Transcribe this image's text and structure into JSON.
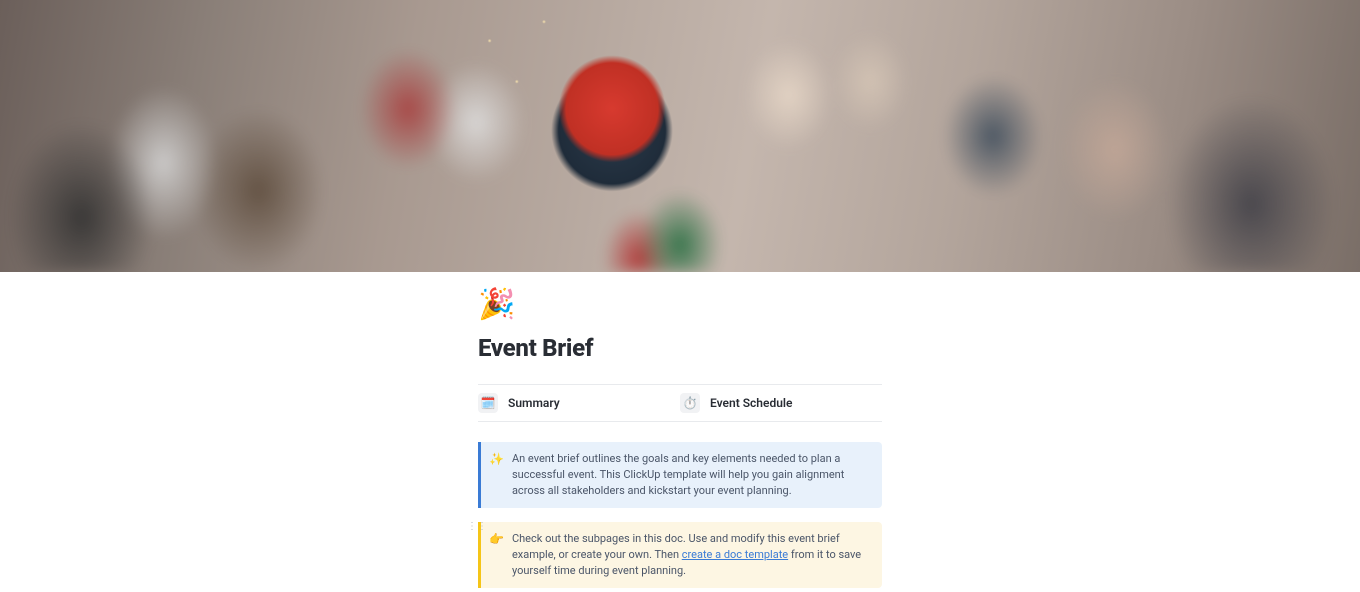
{
  "page": {
    "icon": "🎉",
    "title": "Event Brief"
  },
  "subpages": [
    {
      "icon": "🗓️",
      "label": "Summary"
    },
    {
      "icon": "⏱️",
      "label": "Event Schedule"
    }
  ],
  "callouts": {
    "info": {
      "icon": "✨",
      "text": "An event brief outlines the goals and key elements needed to plan a successful event. This ClickUp template will help you gain alignment across all stakeholders and kickstart your event planning."
    },
    "tip": {
      "icon": "👉",
      "text_before": "Check out the subpages in this doc. Use and modify this event brief example, or create your own. Then ",
      "link_text": "create a doc template",
      "text_after": " from it to save yourself time during event planning."
    }
  }
}
